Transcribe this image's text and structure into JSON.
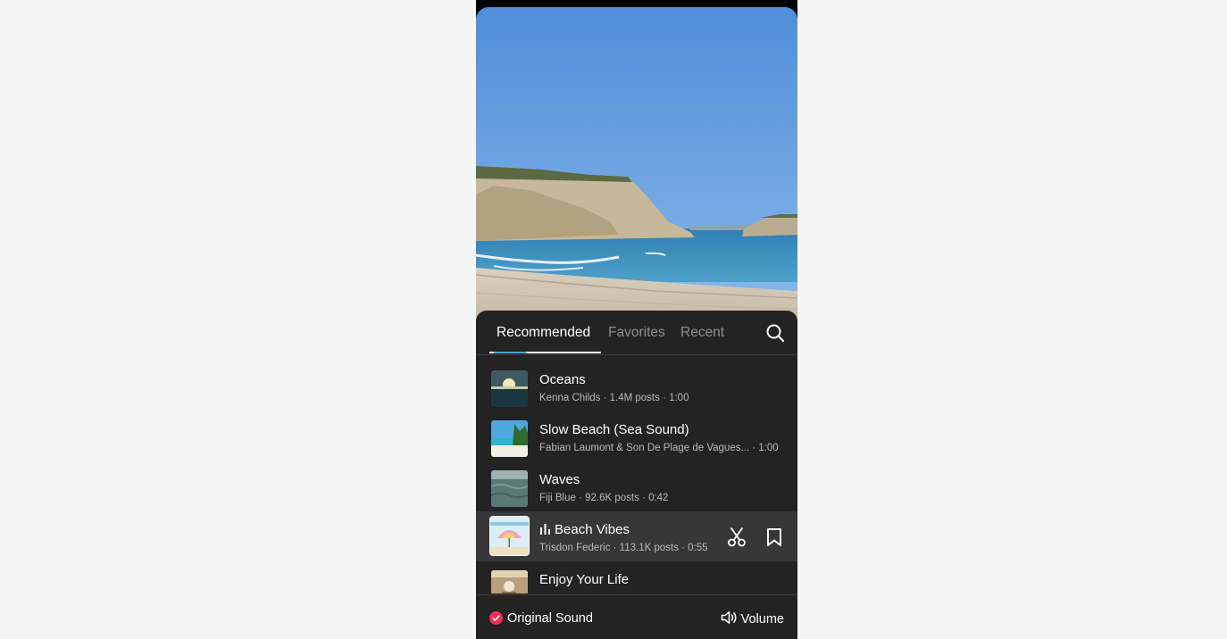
{
  "tabs": [
    {
      "label": "Recommended",
      "active": true
    },
    {
      "label": "Favorites",
      "active": false
    },
    {
      "label": "Recent",
      "active": false
    }
  ],
  "tracks": [
    {
      "title": "Oceans",
      "meta": "Kenna Childs · 1.4M posts · 1:00"
    },
    {
      "title": "Slow Beach (Sea Sound)",
      "meta": "Fabian Laumont & Son De Plage de Vagues... · 1:00"
    },
    {
      "title": "Waves",
      "meta": "Fiji Blue · 92.6K posts · 0:42"
    },
    {
      "title": "Beach Vibes",
      "meta": "Trisdon Federic · 113.1K posts · 0:55",
      "selected": true,
      "playing": true
    },
    {
      "title": "Enjoy Your Life",
      "meta": ""
    }
  ],
  "bottom": {
    "original_sound_label": "Original Sound",
    "original_sound_checked": true,
    "volume_label": "Volume"
  },
  "icons": {
    "search": "search-icon",
    "trim": "scissors-icon",
    "favorite": "bookmark-icon",
    "volume": "speaker-icon",
    "check": "check-icon",
    "playing": "equalizer-icon"
  },
  "colors": {
    "accent": "#fe2c55",
    "panel": "#232323",
    "selected_row": "#373737",
    "tab_indicator": "#4aa3d9"
  }
}
